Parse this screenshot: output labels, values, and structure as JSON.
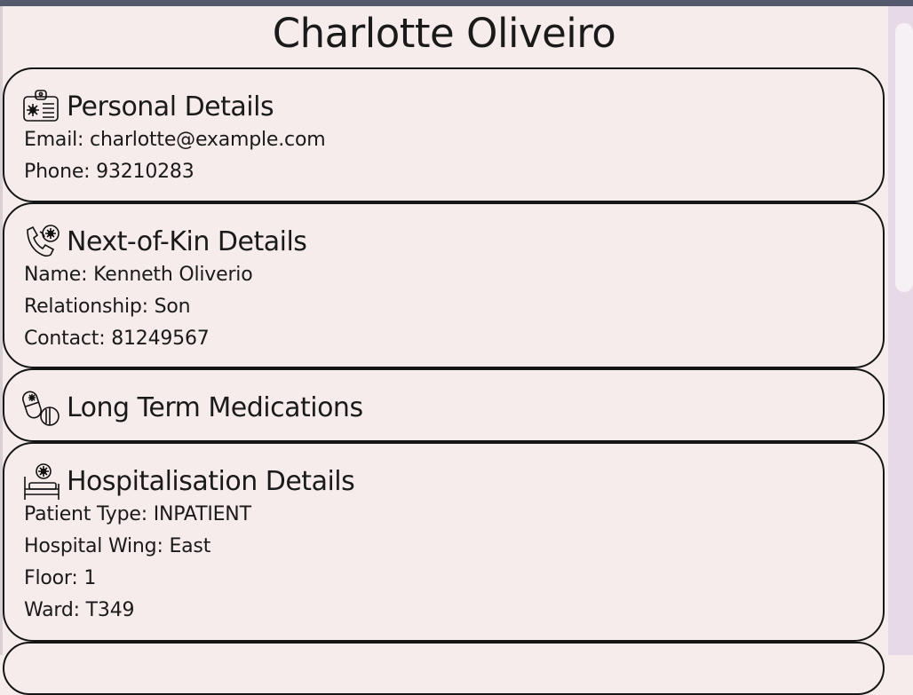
{
  "patient_name": "Charlotte Oliveiro",
  "sections": {
    "personal": {
      "title": "Personal Details",
      "icon": "id-badge-medical-icon",
      "email": "Email: charlotte@example.com",
      "phone": "Phone: 93210283"
    },
    "next_of_kin": {
      "title": "Next-of-Kin Details",
      "icon": "phone-medical-icon",
      "name": "Name: Kenneth Oliverio",
      "relationship": "Relationship: Son",
      "contact": "Contact: 81249567"
    },
    "medications": {
      "title": "Long Term Medications",
      "icon": "pills-icon"
    },
    "hospitalisation": {
      "title": "Hospitalisation Details",
      "icon": "hospital-bed-icon",
      "patient_type": "Patient Type: INPATIENT",
      "wing": "Hospital Wing: East",
      "floor": "Floor: 1",
      "ward": "Ward: T349"
    }
  },
  "colors": {
    "background": "#f7ecec",
    "border": "#151515",
    "scroll_track": "#e8d9e6",
    "topbar": "#555a6e"
  }
}
